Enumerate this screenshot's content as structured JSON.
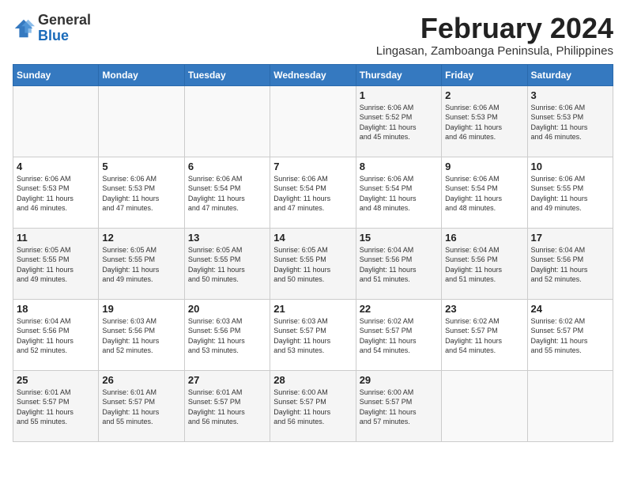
{
  "logo": {
    "general": "General",
    "blue": "Blue"
  },
  "title": "February 2024",
  "subtitle": "Lingasan, Zamboanga Peninsula, Philippines",
  "days_header": [
    "Sunday",
    "Monday",
    "Tuesday",
    "Wednesday",
    "Thursday",
    "Friday",
    "Saturday"
  ],
  "weeks": [
    [
      {
        "day": "",
        "info": ""
      },
      {
        "day": "",
        "info": ""
      },
      {
        "day": "",
        "info": ""
      },
      {
        "day": "",
        "info": ""
      },
      {
        "day": "1",
        "info": "Sunrise: 6:06 AM\nSunset: 5:52 PM\nDaylight: 11 hours\nand 45 minutes."
      },
      {
        "day": "2",
        "info": "Sunrise: 6:06 AM\nSunset: 5:53 PM\nDaylight: 11 hours\nand 46 minutes."
      },
      {
        "day": "3",
        "info": "Sunrise: 6:06 AM\nSunset: 5:53 PM\nDaylight: 11 hours\nand 46 minutes."
      }
    ],
    [
      {
        "day": "4",
        "info": "Sunrise: 6:06 AM\nSunset: 5:53 PM\nDaylight: 11 hours\nand 46 minutes."
      },
      {
        "day": "5",
        "info": "Sunrise: 6:06 AM\nSunset: 5:53 PM\nDaylight: 11 hours\nand 47 minutes."
      },
      {
        "day": "6",
        "info": "Sunrise: 6:06 AM\nSunset: 5:54 PM\nDaylight: 11 hours\nand 47 minutes."
      },
      {
        "day": "7",
        "info": "Sunrise: 6:06 AM\nSunset: 5:54 PM\nDaylight: 11 hours\nand 47 minutes."
      },
      {
        "day": "8",
        "info": "Sunrise: 6:06 AM\nSunset: 5:54 PM\nDaylight: 11 hours\nand 48 minutes."
      },
      {
        "day": "9",
        "info": "Sunrise: 6:06 AM\nSunset: 5:54 PM\nDaylight: 11 hours\nand 48 minutes."
      },
      {
        "day": "10",
        "info": "Sunrise: 6:06 AM\nSunset: 5:55 PM\nDaylight: 11 hours\nand 49 minutes."
      }
    ],
    [
      {
        "day": "11",
        "info": "Sunrise: 6:05 AM\nSunset: 5:55 PM\nDaylight: 11 hours\nand 49 minutes."
      },
      {
        "day": "12",
        "info": "Sunrise: 6:05 AM\nSunset: 5:55 PM\nDaylight: 11 hours\nand 49 minutes."
      },
      {
        "day": "13",
        "info": "Sunrise: 6:05 AM\nSunset: 5:55 PM\nDaylight: 11 hours\nand 50 minutes."
      },
      {
        "day": "14",
        "info": "Sunrise: 6:05 AM\nSunset: 5:55 PM\nDaylight: 11 hours\nand 50 minutes."
      },
      {
        "day": "15",
        "info": "Sunrise: 6:04 AM\nSunset: 5:56 PM\nDaylight: 11 hours\nand 51 minutes."
      },
      {
        "day": "16",
        "info": "Sunrise: 6:04 AM\nSunset: 5:56 PM\nDaylight: 11 hours\nand 51 minutes."
      },
      {
        "day": "17",
        "info": "Sunrise: 6:04 AM\nSunset: 5:56 PM\nDaylight: 11 hours\nand 52 minutes."
      }
    ],
    [
      {
        "day": "18",
        "info": "Sunrise: 6:04 AM\nSunset: 5:56 PM\nDaylight: 11 hours\nand 52 minutes."
      },
      {
        "day": "19",
        "info": "Sunrise: 6:03 AM\nSunset: 5:56 PM\nDaylight: 11 hours\nand 52 minutes."
      },
      {
        "day": "20",
        "info": "Sunrise: 6:03 AM\nSunset: 5:56 PM\nDaylight: 11 hours\nand 53 minutes."
      },
      {
        "day": "21",
        "info": "Sunrise: 6:03 AM\nSunset: 5:57 PM\nDaylight: 11 hours\nand 53 minutes."
      },
      {
        "day": "22",
        "info": "Sunrise: 6:02 AM\nSunset: 5:57 PM\nDaylight: 11 hours\nand 54 minutes."
      },
      {
        "day": "23",
        "info": "Sunrise: 6:02 AM\nSunset: 5:57 PM\nDaylight: 11 hours\nand 54 minutes."
      },
      {
        "day": "24",
        "info": "Sunrise: 6:02 AM\nSunset: 5:57 PM\nDaylight: 11 hours\nand 55 minutes."
      }
    ],
    [
      {
        "day": "25",
        "info": "Sunrise: 6:01 AM\nSunset: 5:57 PM\nDaylight: 11 hours\nand 55 minutes."
      },
      {
        "day": "26",
        "info": "Sunrise: 6:01 AM\nSunset: 5:57 PM\nDaylight: 11 hours\nand 55 minutes."
      },
      {
        "day": "27",
        "info": "Sunrise: 6:01 AM\nSunset: 5:57 PM\nDaylight: 11 hours\nand 56 minutes."
      },
      {
        "day": "28",
        "info": "Sunrise: 6:00 AM\nSunset: 5:57 PM\nDaylight: 11 hours\nand 56 minutes."
      },
      {
        "day": "29",
        "info": "Sunrise: 6:00 AM\nSunset: 5:57 PM\nDaylight: 11 hours\nand 57 minutes."
      },
      {
        "day": "",
        "info": ""
      },
      {
        "day": "",
        "info": ""
      }
    ]
  ]
}
